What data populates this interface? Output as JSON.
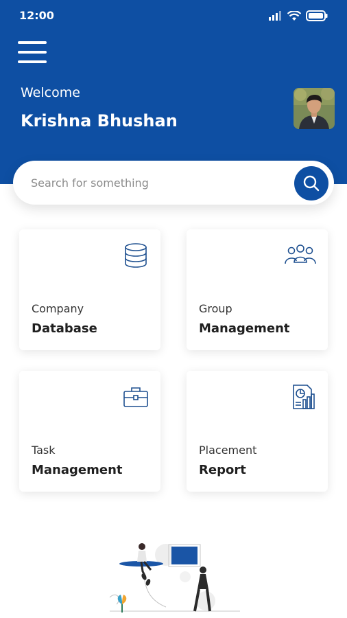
{
  "status_bar": {
    "time": "12:00"
  },
  "header": {
    "welcome": "Welcome",
    "user_name": "Krishna Bhushan"
  },
  "search": {
    "placeholder": "Search for something"
  },
  "cards": [
    {
      "line1": "Company",
      "line2": "Database",
      "icon": "database-icon"
    },
    {
      "line1": "Group",
      "line2": "Management",
      "icon": "group-icon"
    },
    {
      "line1": "Task",
      "line2": "Management",
      "icon": "briefcase-icon"
    },
    {
      "line1": "Placement",
      "line2": "Report",
      "icon": "report-icon"
    }
  ],
  "colors": {
    "brand": "#0e4fa3",
    "card_bg": "#ffffff",
    "text_dark": "#1f1f1f"
  }
}
